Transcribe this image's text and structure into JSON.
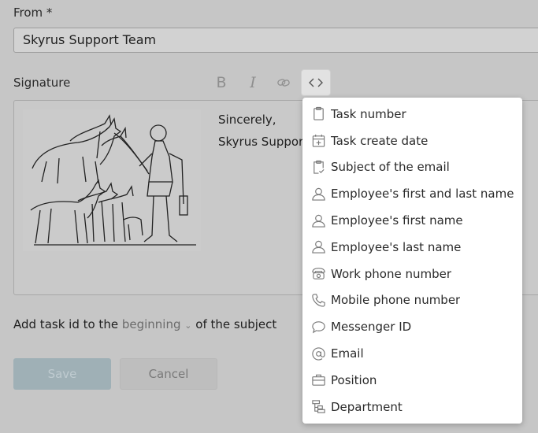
{
  "form": {
    "from_label": "From *",
    "from_value": "Skyrus Support Team",
    "signature_label": "Signature"
  },
  "toolbar": {
    "bold": "B",
    "italic": "I",
    "link_icon": "link-icon",
    "code_icon": "code-icon"
  },
  "signature": {
    "line1": "Sincerely,",
    "line2": "Skyrus Support"
  },
  "task_id": {
    "prefix": "Add task id to the",
    "selected": "beginning",
    "suffix": "of the subject"
  },
  "buttons": {
    "save": "Save",
    "cancel": "Cancel"
  },
  "placeholder_menu": {
    "items": [
      {
        "label": "Task number",
        "icon": "clipboard-icon"
      },
      {
        "label": "Task create date",
        "icon": "calendar-plus-icon"
      },
      {
        "label": "Subject of the email",
        "icon": "clipboard-check-icon"
      },
      {
        "label": "Employee's first and last name",
        "icon": "user-icon"
      },
      {
        "label": "Employee's first name",
        "icon": "user-icon"
      },
      {
        "label": "Employee's last name",
        "icon": "user-icon"
      },
      {
        "label": "Work phone number",
        "icon": "desk-phone-icon"
      },
      {
        "label": "Mobile phone number",
        "icon": "phone-icon"
      },
      {
        "label": "Messenger ID",
        "icon": "chat-bubble-icon"
      },
      {
        "label": "Email",
        "icon": "at-icon"
      },
      {
        "label": "Position",
        "icon": "briefcase-icon"
      },
      {
        "label": "Department",
        "icon": "org-chart-icon"
      }
    ]
  }
}
